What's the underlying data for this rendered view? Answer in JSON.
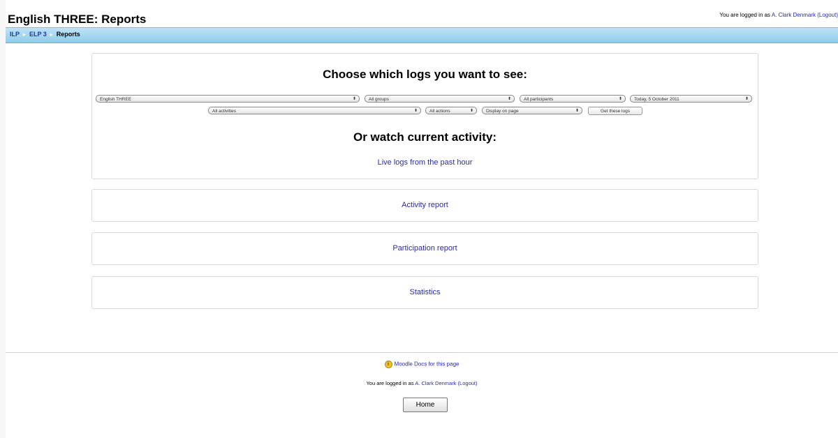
{
  "header": {
    "title": "English THREE: Reports",
    "login_prefix": "You are logged in as",
    "user_name": "A. Clark Denmark",
    "logout_label": "(Logout)"
  },
  "breadcrumb": {
    "items": [
      "ILP",
      "ELP 3",
      "Reports"
    ]
  },
  "logs": {
    "heading": "Choose which logs you want to see:",
    "selects": {
      "course": "English THREE",
      "groups": "All groups",
      "participants": "All participants",
      "date": "Today, 5 October 2011",
      "activities": "All activities",
      "actions": "All actions",
      "display": "Display on page"
    },
    "get_logs_button": "Get these logs",
    "watch_heading": "Or watch current activity:",
    "live_logs_link": "Live logs from the past hour"
  },
  "reports": {
    "activity": "Activity report",
    "participation": "Participation report",
    "statistics": "Statistics"
  },
  "footer": {
    "docs_link": "Moodle Docs for this page",
    "login_prefix": "You are logged in as",
    "user_name": "A. Clark Denmark",
    "logout_label": "(Logout)",
    "home_button": "Home"
  }
}
